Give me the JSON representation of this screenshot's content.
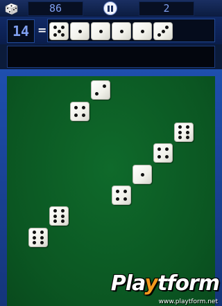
{
  "status_bar": {
    "score": "86",
    "count": "2",
    "app_icon": "dice-icon",
    "pause_icon": "pause-icon"
  },
  "equation": {
    "target": "14",
    "equals": "=",
    "slots": [
      5,
      1,
      1,
      1,
      1,
      3
    ]
  },
  "message": "",
  "table": {
    "dice": [
      {
        "value": 2
      },
      {
        "value": 4
      },
      {
        "value": 6
      },
      {
        "value": 4
      },
      {
        "value": 1
      },
      {
        "value": 4
      },
      {
        "value": 6
      },
      {
        "value": 6
      }
    ]
  },
  "colors": {
    "felt": "#0b5622",
    "frame": "#1e4fae",
    "readout_text": "#7f9ff0"
  },
  "watermark": {
    "logo_left": "Pla",
    "logo_y": "y",
    "logo_right": "tform",
    "url": "www.playtform.net"
  }
}
